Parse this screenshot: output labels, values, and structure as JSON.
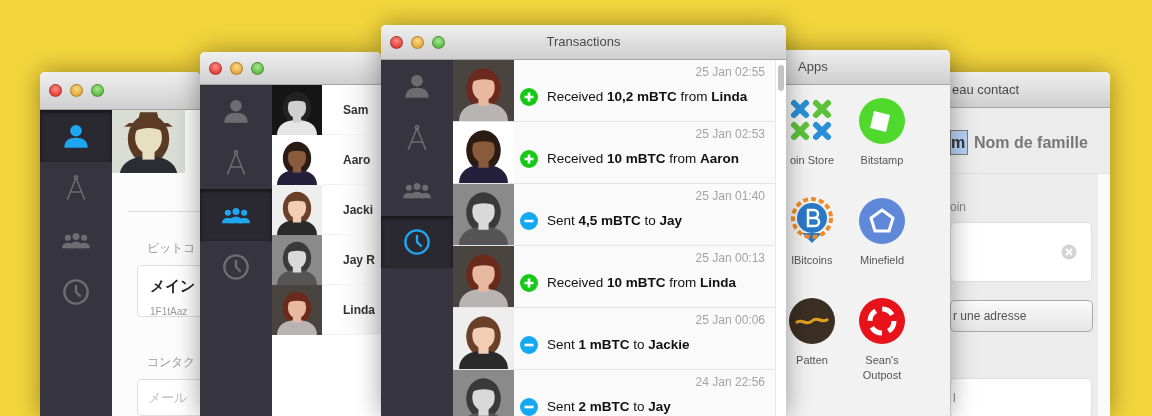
{
  "contact_window": {
    "sidebar": [
      {
        "selected": true
      },
      {
        "selected": false
      },
      {
        "selected": false
      },
      {
        "selected": false
      }
    ],
    "address_label": "ビットコ",
    "address_card": {
      "title": "メイン",
      "address": "1F1tAaz"
    },
    "contact_label": "コンタク",
    "email_field": {
      "placeholder": "メール"
    }
  },
  "contacts_window": {
    "sidebar": [
      {
        "selected": false
      },
      {
        "selected": false
      },
      {
        "selected": true
      },
      {
        "selected": false
      }
    ],
    "contacts": [
      {
        "name": "Sam"
      },
      {
        "name": "Aaro"
      },
      {
        "name": "Jacki"
      },
      {
        "name": "Jay R"
      },
      {
        "name": "Linda"
      }
    ]
  },
  "transactions_window": {
    "title": "Transactions",
    "sidebar": [
      {
        "selected": false
      },
      {
        "selected": false
      },
      {
        "selected": false
      },
      {
        "selected": true
      }
    ],
    "transactions": [
      {
        "kind": "received",
        "time": "25 Jan 02:55",
        "text": "Received **10,2 mBTC** from **Linda**"
      },
      {
        "kind": "received",
        "time": "25 Jan 02:53",
        "text": "Received **10 mBTC** from **Aaron**"
      },
      {
        "kind": "sent",
        "time": "25 Jan 01:40",
        "text": "Sent **4,5 mBTC** to **Jay**"
      },
      {
        "kind": "received",
        "time": "25 Jan 00:13",
        "text": "Received **10 mBTC** from **Linda**"
      },
      {
        "kind": "sent",
        "time": "25 Jan 00:06",
        "text": "Sent **1 mBTC** to **Jackie**"
      },
      {
        "kind": "sent",
        "time": "24 Jan 22:56",
        "text": "Sent **2 mBTC** to **Jay**"
      }
    ]
  },
  "apps_window": {
    "title": "Apps",
    "apps": [
      {
        "label": "oin Store"
      },
      {
        "label": "Bitstamp"
      },
      {
        "label": "lBitcoins"
      },
      {
        "label": "Minefield"
      },
      {
        "label": "Patten"
      },
      {
        "label": "Sean's Outpost"
      }
    ]
  },
  "new_contact_window": {
    "title": "eau contact",
    "first_name_field": {
      "value": "m"
    },
    "last_name_field": {
      "placeholder": "Nom de famille"
    },
    "address_label": "oin",
    "add_address_button": "r une adresse",
    "bottom_field": {
      "placeholder": "l"
    }
  }
}
